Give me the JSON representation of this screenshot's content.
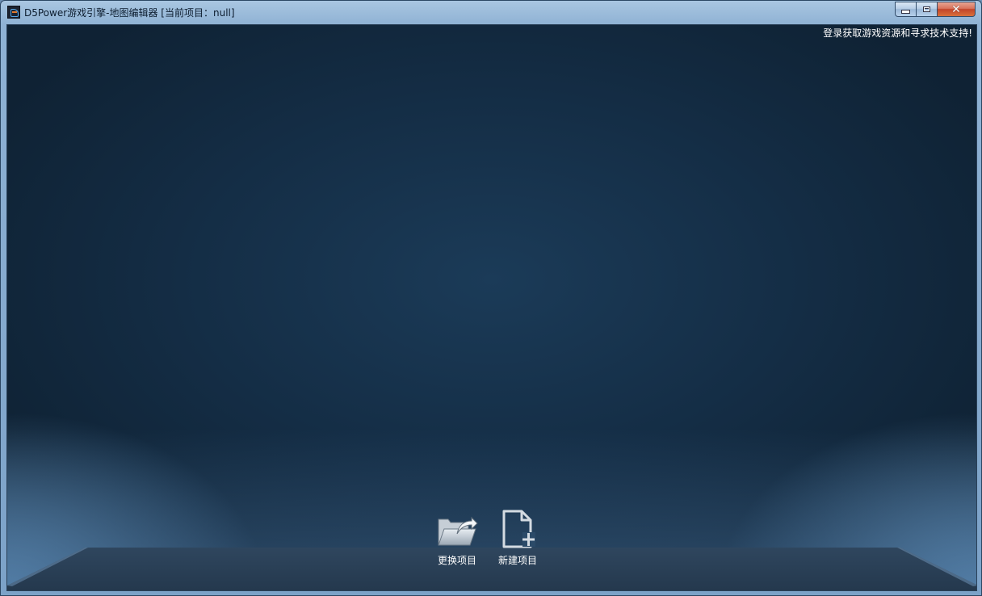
{
  "window": {
    "title": "D5Power游戏引擎-地图编辑器 [当前项目：null]",
    "controls": {
      "minimize_icon": "minimize-icon",
      "maximize_icon": "maximize-icon",
      "close_icon": "close-icon"
    }
  },
  "header": {
    "login_link": "登录获取游戏资源和寻求技术支持!"
  },
  "actions": [
    {
      "label": "更换项目",
      "icon": "folder-open-icon"
    },
    {
      "label": "新建项目",
      "icon": "new-file-icon"
    }
  ],
  "colors": {
    "background_dark": "#0f2234",
    "background_mid": "#1b3b58",
    "floor": "#2b4058",
    "text": "#ffffff"
  }
}
